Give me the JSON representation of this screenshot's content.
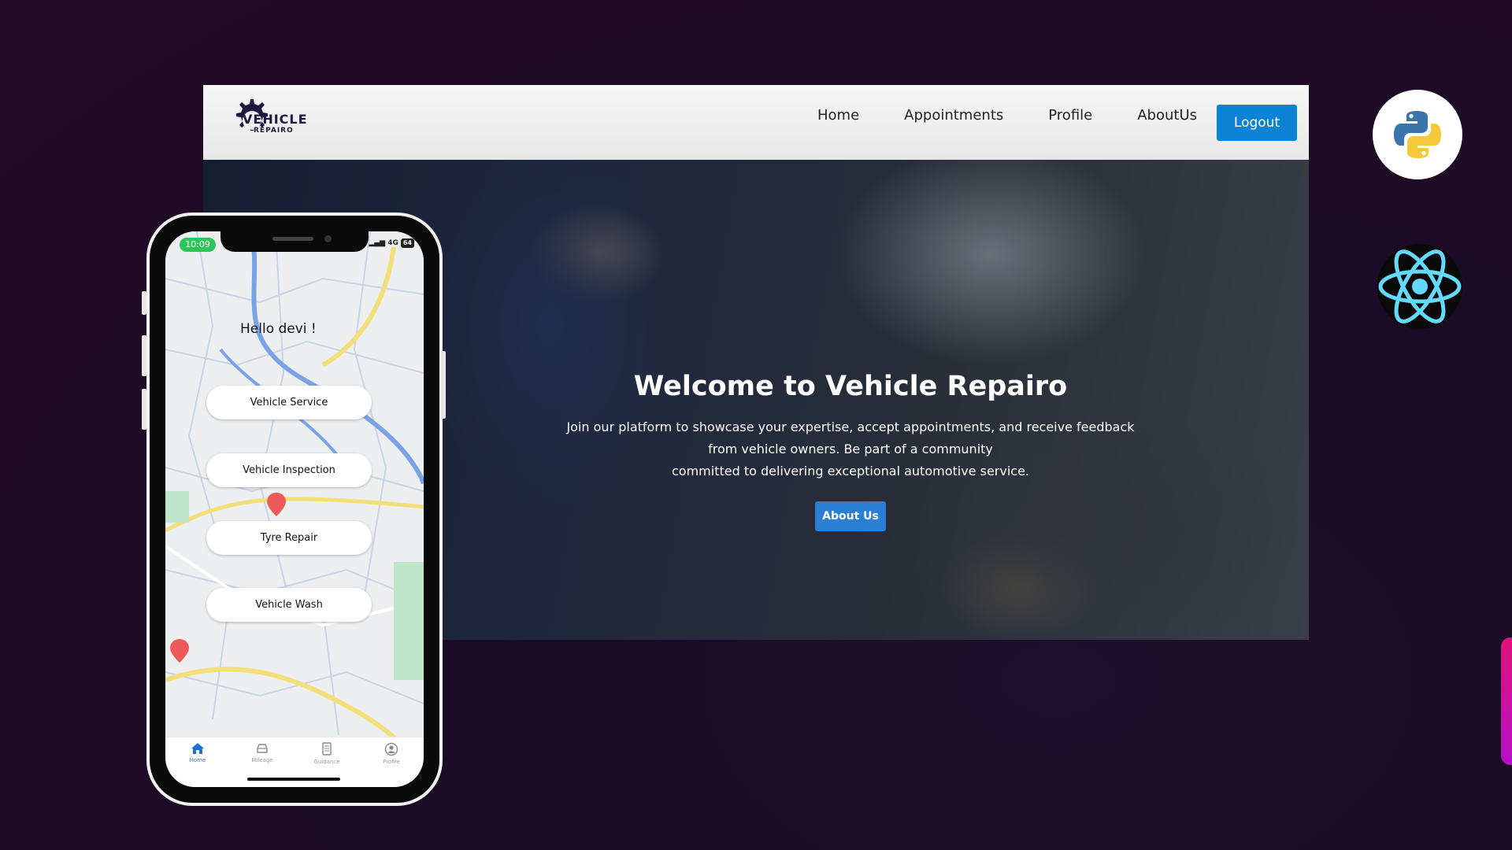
{
  "site": {
    "logo": {
      "line1": "VEHICLE",
      "line2": "REPAIRO"
    },
    "nav": [
      "Home",
      "Appointments",
      "Profile",
      "AboutUs"
    ],
    "logout_label": "Logout",
    "hero": {
      "title": "Welcome to Vehicle Repairo",
      "line1": "Join our platform to showcase your expertise, accept appointments, and receive feedback",
      "line2": "from vehicle owners. Be part of a community",
      "line3": "committed to delivering exceptional automotive service.",
      "button_label": "About Us"
    }
  },
  "phone": {
    "time": "10:09",
    "network": "4G",
    "battery": "64",
    "greeting": "Hello devi !",
    "services": [
      "Vehicle Service",
      "Vehicle Inspection",
      "Tyre Repair",
      "Vehicle Wash"
    ],
    "tabs": [
      {
        "label": "Home",
        "icon": "home-icon"
      },
      {
        "label": "Mileage",
        "icon": "car-icon"
      },
      {
        "label": "Guidance",
        "icon": "document-icon"
      },
      {
        "label": "Profile",
        "icon": "user-icon"
      }
    ]
  },
  "tech_logos": [
    "python-icon",
    "react-icon"
  ],
  "colors": {
    "background": "#200a28",
    "primary": "#0d83d6",
    "accent": "#e0127a"
  }
}
